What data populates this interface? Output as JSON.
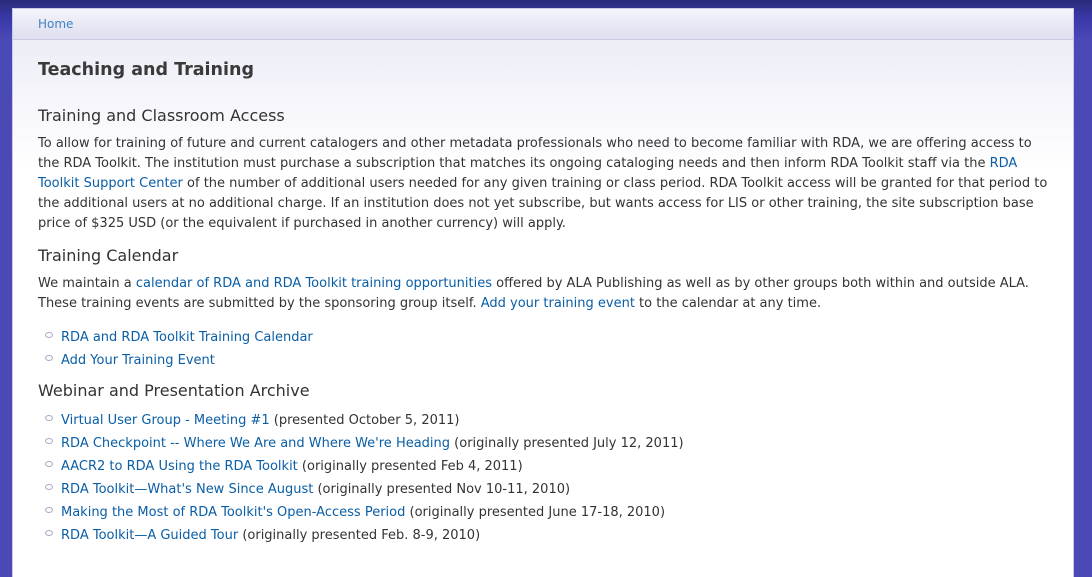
{
  "breadcrumb": {
    "home": "Home"
  },
  "page_title": "Teaching and Training",
  "training_access": {
    "heading": "Training and Classroom Access",
    "text_1": "To allow for training of future and current catalogers and other metadata professionals who need to become familiar with RDA, we are offering access to the RDA Toolkit. The institution must purchase a subscription that matches its ongoing cataloging needs and then inform RDA Toolkit staff via the ",
    "link_support": "RDA Toolkit Support Center",
    "text_2": " of the number of additional users needed for any given training or class period. RDA Toolkit access will be granted for that period to the additional users at no additional charge. If an institution does not yet subscribe, but wants access for LIS or other training, the site subscription base price of $325 USD (or the equivalent if purchased in another currency) will apply."
  },
  "training_calendar": {
    "heading": "Training Calendar",
    "text_1": "We maintain a ",
    "link_calendar": "calendar of RDA and RDA Toolkit training opportunities",
    "text_2": " offered by ALA Publishing as well as by other groups both within and outside ALA. These training events are submitted by the sponsoring group itself. ",
    "link_add": "Add your training event",
    "text_3": " to the calendar at any time.",
    "items": [
      {
        "label": "RDA and RDA Toolkit Training Calendar"
      },
      {
        "label": "Add Your Training Event"
      }
    ]
  },
  "webinar_archive": {
    "heading": "Webinar and Presentation Archive",
    "items": [
      {
        "label": "Virtual User Group - Meeting #1",
        "note": " (presented October 5, 2011)"
      },
      {
        "label": "RDA Checkpoint -- Where We Are and Where We're Heading",
        "note": " (originally presented July 12, 2011)"
      },
      {
        "label": "AACR2 to RDA Using the RDA Toolkit",
        "note": " (originally presented Feb 4, 2011)"
      },
      {
        "label": "RDA Toolkit—What's New Since August",
        "note": " (originally presented Nov 10-11, 2010)"
      },
      {
        "label": "Making the Most of RDA Toolkit's Open-Access Period",
        "note": " (originally presented June 17-18, 2010)"
      },
      {
        "label": "RDA Toolkit—A Guided Tour",
        "note": " (originally presented Feb. 8-9, 2010)"
      }
    ]
  },
  "colors": {
    "link": "#0a5ea6",
    "breadcrumb_link": "#3f83c4",
    "background": "#4b49b6"
  }
}
